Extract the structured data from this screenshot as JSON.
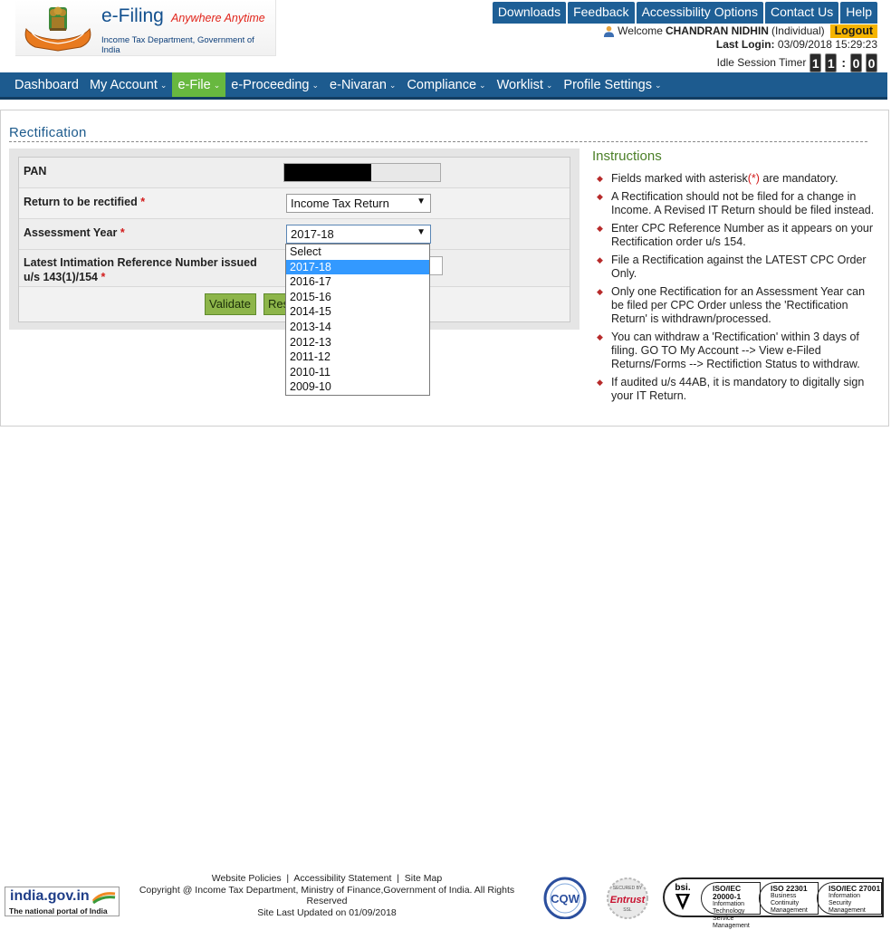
{
  "header": {
    "brand_name": "e-Filing",
    "brand_tagline": "Anywhere Anytime",
    "department": "Income Tax Department, Government of India",
    "top_links": [
      "Downloads",
      "Feedback",
      "Accessibility Options",
      "Contact Us",
      "Help"
    ],
    "welcome_prefix": "Welcome",
    "user_name": "CHANDRAN NIDHIN",
    "user_type": "(Individual)",
    "logout_label": "Logout",
    "last_login_label": "Last Login:",
    "last_login_value": "03/09/2018 15:29:23",
    "idle_timer_label": "Idle Session Timer",
    "timer_digits": [
      "1",
      "1",
      "0",
      "0"
    ]
  },
  "nav": {
    "items": [
      {
        "label": "Dashboard",
        "dropdown": false,
        "active": false
      },
      {
        "label": "My Account",
        "dropdown": true,
        "active": false
      },
      {
        "label": "e-File",
        "dropdown": true,
        "active": true
      },
      {
        "label": "e-Proceeding",
        "dropdown": true,
        "active": false
      },
      {
        "label": "e-Nivaran",
        "dropdown": true,
        "active": false
      },
      {
        "label": "Compliance",
        "dropdown": true,
        "active": false
      },
      {
        "label": "Worklist",
        "dropdown": true,
        "active": false
      },
      {
        "label": "Profile Settings",
        "dropdown": true,
        "active": false
      }
    ],
    "caret_glyph": "⌄"
  },
  "page": {
    "title": "Rectification"
  },
  "form": {
    "pan_label": "PAN",
    "return_label": "Return to be rectified",
    "return_value": "Income Tax Return",
    "ay_label": "Assessment Year",
    "ay_value": "2017-18",
    "ref_label_line1": "Latest Intimation Reference Number issued",
    "ref_label_line2": "u/s 143(1)/154",
    "required_mark": "*",
    "validate_label": "Validate",
    "reset_label": "Reset",
    "ay_options": [
      "Select",
      "2017-18",
      "2016-17",
      "2015-16",
      "2014-15",
      "2013-14",
      "2012-13",
      "2011-12",
      "2010-11",
      "2009-10"
    ],
    "ay_selected_index": 1
  },
  "instructions": {
    "title": "Instructions",
    "item1_pre": "Fields marked with asterisk",
    "item1_mark": "(*)",
    "item1_post": " are mandatory.",
    "items": [
      "A Rectification should not be filed for a change in Income. A Revised IT Return should be filed instead.",
      "Enter CPC Reference Number as it appears on your Rectification order u/s 154.",
      "File a Rectification against the LATEST CPC Order Only.",
      "Only one Rectification for an Assessment Year can be filed per CPC Order unless the 'Rectification Return' is withdrawn/processed.",
      "You can withdraw a 'Rectification' within 3 days of filing. GO TO My Account --> View e-Filed Returns/Forms --> Rectifiction Status to withdraw.",
      "If audited u/s 44AB, it is mandatory to digitally sign your IT Return."
    ]
  },
  "footer": {
    "links": [
      "Website Policies",
      "Accessibility Statement",
      "Site Map"
    ],
    "copyright": "Copyright @ Income Tax Department, Ministry of Finance,Government of India. All Rights Reserved",
    "site_updated": "Site Last Updated on 01/09/2018",
    "india_portal_name": "india.gov.in",
    "india_portal_sub": "The national portal of India",
    "badges": {
      "cqw": "CQW",
      "entrust": "Entrust",
      "entrust_secured": "SECURED BY",
      "entrust_ssl": "SSL",
      "bsi": "bsi.",
      "certs": [
        {
          "code": "ISO/IEC 20000-1",
          "desc": "Information Technology Service Management"
        },
        {
          "code": "ISO 22301",
          "desc": "Business Continuity Management"
        },
        {
          "code": "ISO/IEC 27001",
          "desc": "Information Security Management"
        }
      ]
    }
  },
  "colors": {
    "nav_blue": "#1d5b8f",
    "active_green": "#68b83f",
    "logout_yellow": "#f5b400",
    "button_green": "#8db54a",
    "title_blue": "#1c5a8c",
    "instructions_green": "#4b7f27",
    "required_red": "#d21b1b"
  }
}
